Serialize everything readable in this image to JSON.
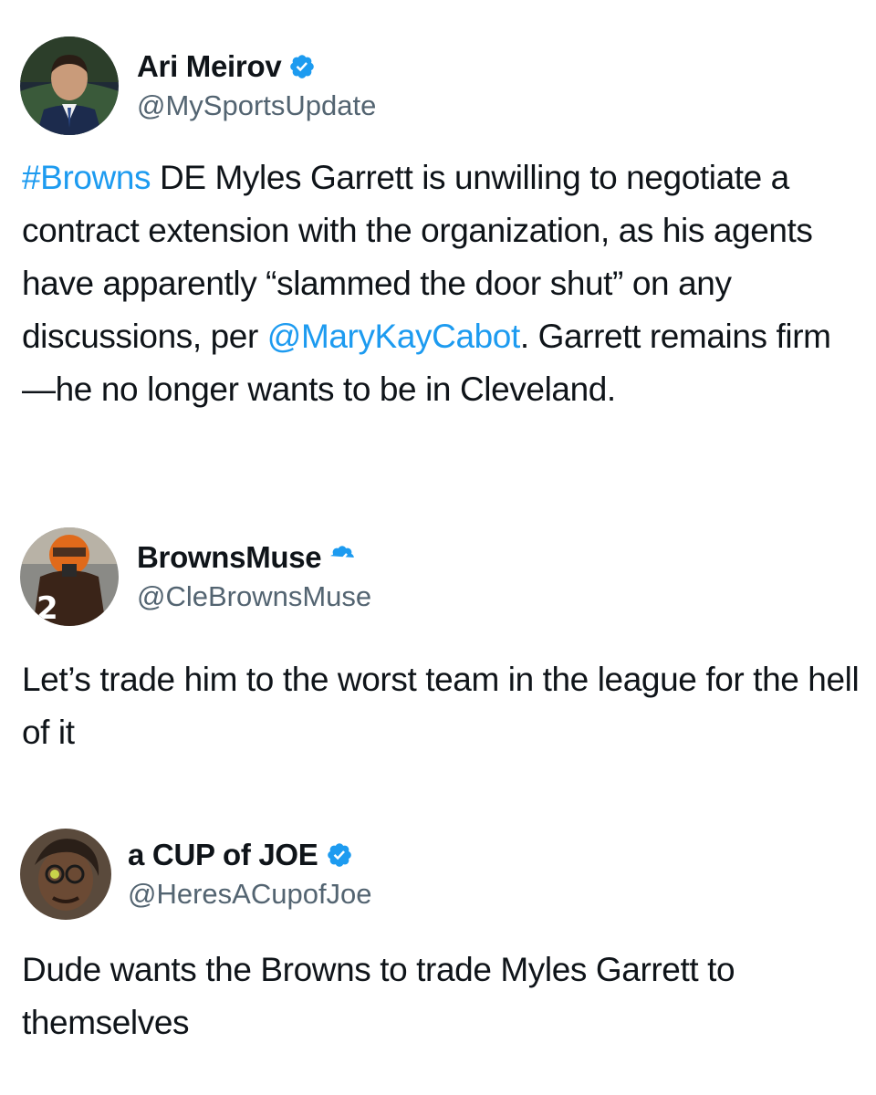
{
  "colors": {
    "text": "#0f1419",
    "handle": "#536471",
    "link": "#1d9bf0",
    "verified_badge": "#1d9bf0"
  },
  "tweets": [
    {
      "display_name": "Ari Meirov",
      "handle": "@MySportsUpdate",
      "verified_icon": "verified-badge-icon",
      "text": {
        "hashtag": "#Browns",
        "part1": " DE Myles Garrett is unwilling to negotiate a contract extension with the organization, as his agents have apparently “slammed the door shut” on any discussions, per ",
        "mention": "@MaryKayCabot",
        "part2": ". Garrett remains firm—he no longer wants to be in Cleveland."
      }
    },
    {
      "display_name": "BrownsMuse",
      "handle": "@CleBrownsMuse",
      "verified_icon": "verified-badge-icon",
      "text": "Let’s trade him to the worst team in the league for the hell of it"
    },
    {
      "display_name": "a CUP of JOE",
      "handle": "@HeresACupofJoe",
      "verified_icon": "verified-badge-icon",
      "text": "Dude wants the Browns to trade Myles Garrett to themselves"
    }
  ]
}
